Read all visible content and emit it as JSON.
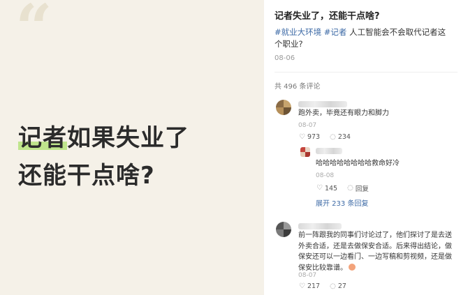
{
  "cover": {
    "quote_mark": "“",
    "line1_highlight": "记者",
    "line1_rest": "如果失业了",
    "line2": "还能干点啥?",
    "highlight_color": "#bfe58c"
  },
  "post": {
    "title": "记者失业了，还能干点啥?",
    "tags": [
      "#就业大环境",
      "#记者"
    ],
    "desc_text": " 人工智能会不会取代记者这个职业?",
    "date": "08-06",
    "comment_count_label": "共 496 条评论",
    "link_color": "#3d6aa6"
  },
  "comments": [
    {
      "text": "跑外卖，毕竟还有眼力和脚力",
      "date": "08-07",
      "likes": "973",
      "replies": "234",
      "reply": {
        "text": "哈哈哈哈哈哈哈哈救命好冷",
        "date": "08-08",
        "likes": "145",
        "reply_label": "回复"
      },
      "expand_label": "展开 233 条回复"
    },
    {
      "text": "前一阵跟我的同事们讨论过了，他们探讨了是去送外卖合适，还是去做保安合适。后来得出结论，做保安还可以一边看门、一边写稿和剪视频，还是做保安比较靠谱。",
      "date": "08-07",
      "likes": "217",
      "replies": "27"
    }
  ],
  "icons": {
    "heart": "heart-icon",
    "comment": "comment-bubble-icon"
  }
}
